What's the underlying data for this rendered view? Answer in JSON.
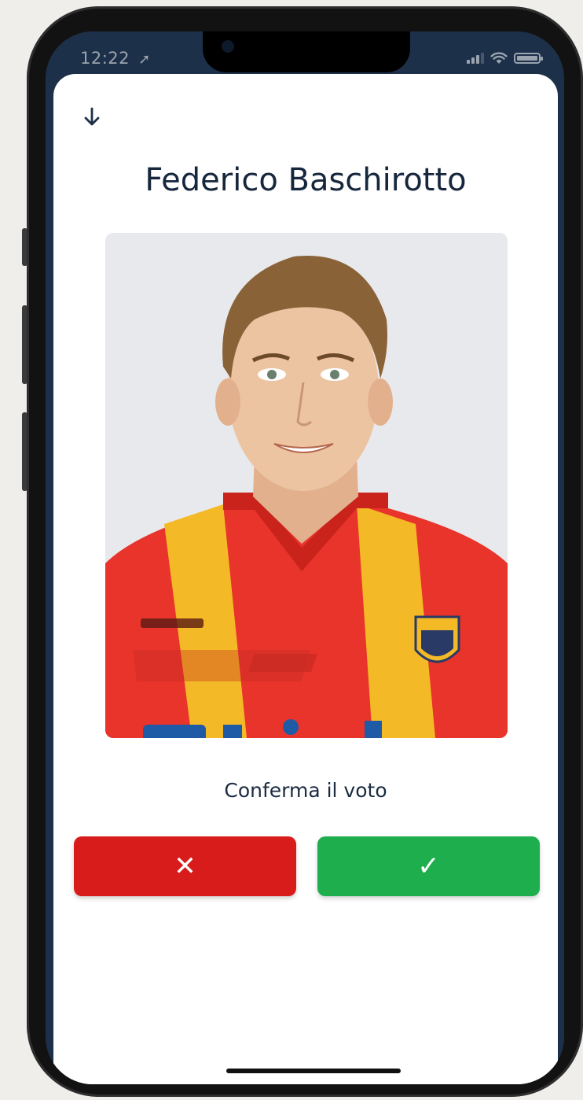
{
  "status_bar": {
    "time": "12:22",
    "location_icon": "location-arrow-icon",
    "signal_icon": "cellular-signal-icon",
    "wifi_icon": "wifi-icon",
    "battery_icon": "battery-icon"
  },
  "header": {
    "back_icon": "arrow-down-icon"
  },
  "player": {
    "name": "Federico Baschirotto",
    "photo_icon": "player-photo"
  },
  "confirm": {
    "label": "Conferma il voto",
    "reject_glyph": "✕",
    "accept_glyph": "✓"
  },
  "colors": {
    "screen_bg": "#1d3049",
    "reject": "#d81b1b",
    "accept": "#1fae4d",
    "title_text": "#16263d",
    "jersey_red": "#e8342a",
    "jersey_yellow": "#f4b927"
  }
}
